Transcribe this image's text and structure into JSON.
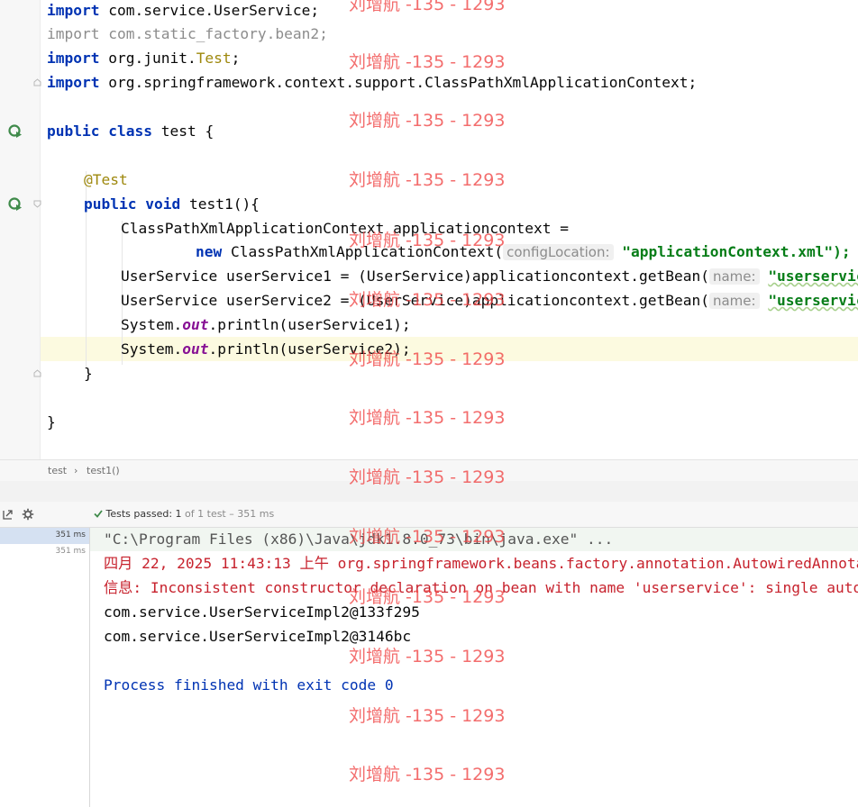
{
  "editor": {
    "lines": {
      "import1": {
        "kw": "import",
        "text": " com.service.UserService;"
      },
      "import2": {
        "kw": "import",
        "text": " com.static_factory.bean2;"
      },
      "import3": {
        "kw": "import",
        "pre": " org.junit.",
        "ann": "Test",
        "post": ";"
      },
      "import4": {
        "kw": "import",
        "text": " org.springframework.context.support.ClassPathXmlApplicationContext;"
      },
      "class_decl": {
        "kw1": "public",
        "kw2": "class",
        "text": " test {"
      },
      "annotation": "@Test",
      "method_decl": {
        "kw1": "public",
        "kw2": "void",
        "text": " test1(){"
      },
      "ctx_decl": "ClassPathXmlApplicationContext applicationcontext =",
      "ctx_new": {
        "kw": "new",
        "text": " ClassPathXmlApplicationContext(",
        "hint": "configLocation:",
        "str": "\"applicationContext.xml\");"
      },
      "bean1": {
        "text": "UserService userService1 = (UserService)applicationcontext.getBean(",
        "hint": "name:",
        "str": "\"userservice\");"
      },
      "bean2": {
        "text": "UserService userService2 = (UserService)applicationcontext.getBean(",
        "hint": "name:",
        "str": "\"userservice\");"
      },
      "print1": {
        "pre": "System.",
        "field": "out",
        "post": ".println(userService1);"
      },
      "print2": {
        "pre": "System.",
        "field": "out",
        "post": ".println(userService2);"
      },
      "close_method": "}",
      "close_class": "}"
    }
  },
  "breadcrumb": {
    "class_name": "test",
    "separator": "›",
    "method_name": "test1()"
  },
  "run": {
    "tests_passed_label": "Tests passed:",
    "passed_count": "1",
    "of_total": "of 1 test",
    "duration": "– 351 ms",
    "tree_times": [
      "351 ms",
      "351 ms"
    ],
    "console": {
      "cmd": "\"C:\\Program Files (x86)\\Java\\jdk1.8.0_73\\bin\\java.exe\" ...",
      "log_date": "四月 22, 2025 11:43:13 上午 org.springframework.beans.factory.annotation.AutowiredAnnotationBeanPostProcessor",
      "log_info": "信息: Inconsistent constructor declaration on bean with name 'userservice': single autowire-marked constructor flagged as optional",
      "out1": "com.service.UserServiceImpl2@133f295",
      "out2": "com.service.UserServiceImpl2@3146bc",
      "finished": "Process finished with exit code 0"
    }
  },
  "watermark": "刘增航 -135 - 1293",
  "colors": {
    "keyword": "#0033b3",
    "string": "#067d17",
    "annotation": "#9e880d",
    "field": "#871094",
    "error": "#c7222d",
    "watermark": "#f04545"
  },
  "icons": [
    "run-test-icon",
    "run-test-icon",
    "fold-icon",
    "checkmark-icon",
    "settings-icon",
    "export-icon"
  ]
}
